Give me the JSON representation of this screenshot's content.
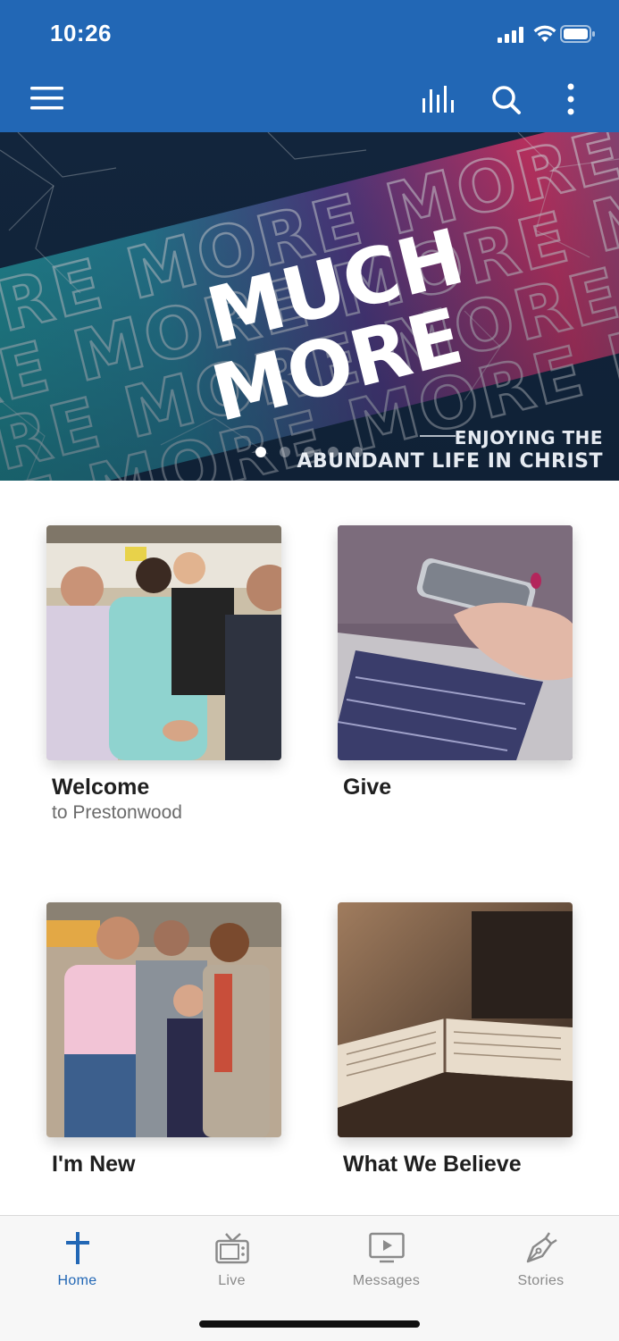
{
  "status_bar": {
    "time": "10:26"
  },
  "theme": {
    "brand_blue": "#2267b5",
    "inactive_gray": "#8a8a8a"
  },
  "toolbar": {
    "menu_icon": "hamburger-icon",
    "audio_icon": "equalizer-icon",
    "search_icon": "search-icon",
    "more_icon": "vertical-dots-icon"
  },
  "hero": {
    "banner_words": [
      "MORE",
      "MUCH",
      "MORE"
    ],
    "caption_line1": "ENJOYING THE",
    "caption_line2": "ABUNDANT LIFE IN CHRIST",
    "slide_count": 5,
    "active_slide": 1
  },
  "cards": [
    {
      "title": "Welcome",
      "subtitle": "to Prestonwood"
    },
    {
      "title": "Give",
      "subtitle": ""
    },
    {
      "title": "I'm New",
      "subtitle": ""
    },
    {
      "title": "What We Believe",
      "subtitle": ""
    }
  ],
  "bottom_nav": [
    {
      "label": "Home",
      "icon": "cross-icon",
      "active": true
    },
    {
      "label": "Live",
      "icon": "tv-icon",
      "active": false
    },
    {
      "label": "Messages",
      "icon": "play-screen-icon",
      "active": false
    },
    {
      "label": "Stories",
      "icon": "pen-icon",
      "active": false
    }
  ]
}
